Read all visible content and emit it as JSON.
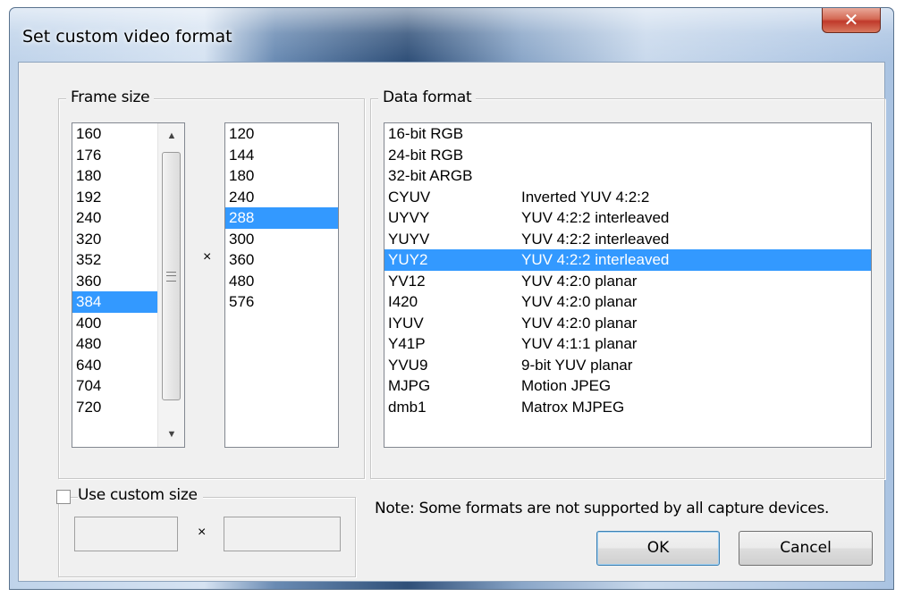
{
  "window": {
    "title": "Set custom video format",
    "close_icon": "close-icon"
  },
  "frame_size": {
    "label": "Frame size",
    "widths": [
      "160",
      "176",
      "180",
      "192",
      "240",
      "320",
      "352",
      "360",
      "384",
      "400",
      "480",
      "640",
      "704",
      "720"
    ],
    "selected_width": "384",
    "times": "×",
    "heights": [
      "120",
      "144",
      "180",
      "240",
      "288",
      "300",
      "360",
      "480",
      "576"
    ],
    "selected_height": "288"
  },
  "data_format": {
    "label": "Data format",
    "items": [
      {
        "code": "16-bit RGB",
        "desc": ""
      },
      {
        "code": "24-bit RGB",
        "desc": ""
      },
      {
        "code": "32-bit ARGB",
        "desc": ""
      },
      {
        "code": "CYUV",
        "desc": "Inverted YUV 4:2:2"
      },
      {
        "code": "UYVY",
        "desc": "YUV 4:2:2 interleaved"
      },
      {
        "code": "YUYV",
        "desc": "YUV 4:2:2 interleaved"
      },
      {
        "code": "YUY2",
        "desc": "YUV 4:2:2 interleaved"
      },
      {
        "code": "YV12",
        "desc": "YUV 4:2:0 planar"
      },
      {
        "code": "I420",
        "desc": "YUV 4:2:0 planar"
      },
      {
        "code": "IYUV",
        "desc": "YUV 4:2:0 planar"
      },
      {
        "code": "Y41P",
        "desc": "YUV 4:1:1 planar"
      },
      {
        "code": "YVU9",
        "desc": "9-bit YUV planar"
      },
      {
        "code": "MJPG",
        "desc": "Motion JPEG"
      },
      {
        "code": "dmb1",
        "desc": "Matrox MJPEG"
      }
    ],
    "selected": "YUY2"
  },
  "custom_size": {
    "label": "Use custom size",
    "checked": false,
    "width_value": "",
    "times": "×",
    "height_value": ""
  },
  "note": "Note: Some formats are not supported by all capture devices.",
  "buttons": {
    "ok": "OK",
    "cancel": "Cancel"
  },
  "colors": {
    "selection": "#3399ff",
    "dialog_bg": "#f0f0f0",
    "close_button": "#c0392b"
  }
}
